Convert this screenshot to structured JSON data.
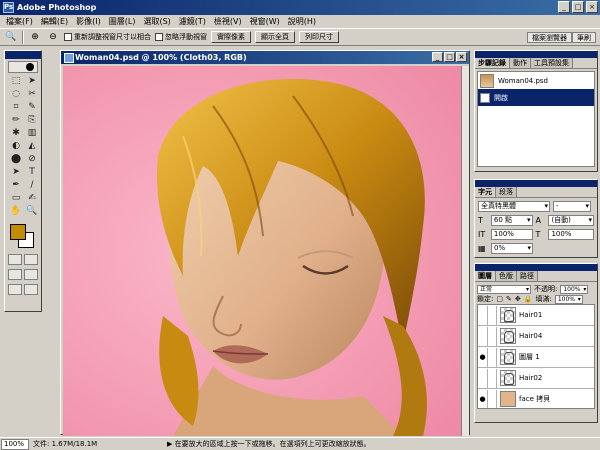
{
  "app": {
    "title": "Adobe Photoshop",
    "icon_label": "Ps"
  },
  "window_controls": {
    "minimize": "_",
    "maximize": "□",
    "close": "×"
  },
  "menu": [
    "檔案(F)",
    "編輯(E)",
    "影像(I)",
    "圖層(L)",
    "選取(S)",
    "濾鏡(T)",
    "檢視(V)",
    "視窗(W)",
    "說明(H)"
  ],
  "options": {
    "tool_icon": "zoom-icon",
    "resize_window_label": "重新調整視窗尺寸以相合",
    "ignore_palettes_label": "忽略浮動視窗",
    "actual_pixels_label": "實際像素",
    "fit_screen_label": "顯示全頁",
    "print_size_label": "列印尺寸",
    "well_tabs": [
      "檔案瀏覽器",
      "筆刷"
    ]
  },
  "document": {
    "title": "Woman04.psd @ 100% (Cloth03, RGB)"
  },
  "toolbox": {
    "tools": [
      "⬚",
      "➤",
      "◌",
      "✂",
      "⌗",
      "✎",
      "✏",
      "⎘",
      "✱",
      "▥",
      "◐",
      "◭",
      "⬤",
      "⊘",
      "➤",
      "T",
      "✒",
      "/",
      "▭",
      "✍",
      "✋",
      "🔍"
    ],
    "fg_color": "#c48a00",
    "bg_color": "#ffffff"
  },
  "history": {
    "tabs": [
      "步驟記錄",
      "動作",
      "工具預設集"
    ],
    "snapshot": "Woman04.psd",
    "states": [
      "開啟"
    ]
  },
  "character": {
    "tabs": [
      "字元",
      "段落"
    ],
    "font_family": "全真特黑體",
    "font_style": "-",
    "size": "60 點",
    "leading": "(自動)",
    "vscale": "100%",
    "hscale": "100%",
    "tracking": "0%"
  },
  "layers": {
    "tabs": [
      "圖層",
      "色版",
      "路徑"
    ],
    "blend_mode": "正常",
    "opacity_label": "不透明:",
    "opacity": "100%",
    "lock_label": "鎖定:",
    "fill_label": "填滿:",
    "fill": "100%",
    "items": [
      {
        "name": "Hair01",
        "visible": "",
        "thumb": "hair"
      },
      {
        "name": "Hair04",
        "visible": "",
        "thumb": "hair"
      },
      {
        "name": "圖層 1",
        "visible": "●",
        "thumb": "hair"
      },
      {
        "name": "Hair02",
        "visible": "",
        "thumb": "hair"
      },
      {
        "name": "face 拷貝",
        "visible": "●",
        "thumb": "face"
      }
    ]
  },
  "status": {
    "zoom": "100%",
    "file_info": "文件: 1.67M/18.1M",
    "message": "▶ 在要放大的區域上按一下或拖移。在選項列上可更改縮放狀態。"
  }
}
